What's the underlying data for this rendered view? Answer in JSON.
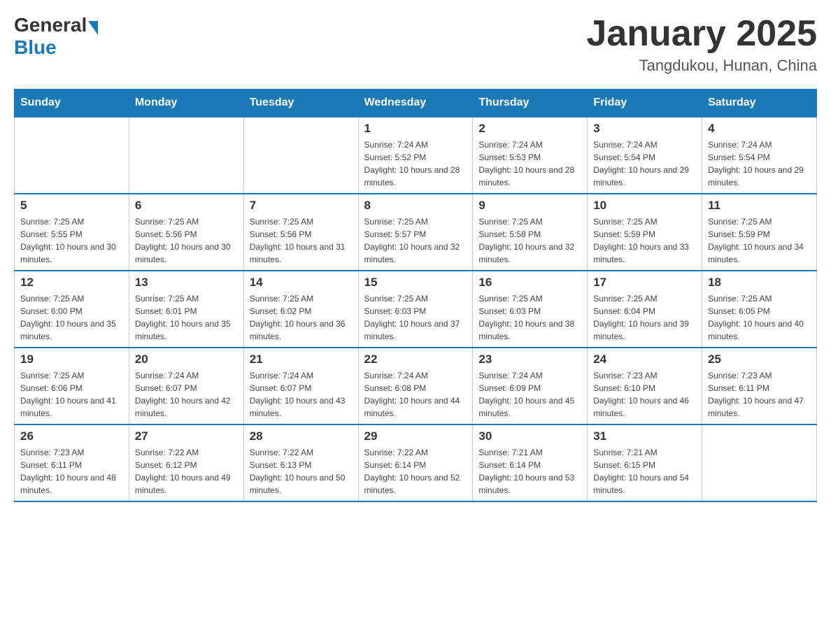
{
  "header": {
    "logo_general": "General",
    "logo_blue": "Blue",
    "month_title": "January 2025",
    "location": "Tangdukou, Hunan, China"
  },
  "days_of_week": [
    "Sunday",
    "Monday",
    "Tuesday",
    "Wednesday",
    "Thursday",
    "Friday",
    "Saturday"
  ],
  "weeks": [
    [
      {
        "day": "",
        "sunrise": "",
        "sunset": "",
        "daylight": ""
      },
      {
        "day": "",
        "sunrise": "",
        "sunset": "",
        "daylight": ""
      },
      {
        "day": "",
        "sunrise": "",
        "sunset": "",
        "daylight": ""
      },
      {
        "day": "1",
        "sunrise": "Sunrise: 7:24 AM",
        "sunset": "Sunset: 5:52 PM",
        "daylight": "Daylight: 10 hours and 28 minutes."
      },
      {
        "day": "2",
        "sunrise": "Sunrise: 7:24 AM",
        "sunset": "Sunset: 5:53 PM",
        "daylight": "Daylight: 10 hours and 28 minutes."
      },
      {
        "day": "3",
        "sunrise": "Sunrise: 7:24 AM",
        "sunset": "Sunset: 5:54 PM",
        "daylight": "Daylight: 10 hours and 29 minutes."
      },
      {
        "day": "4",
        "sunrise": "Sunrise: 7:24 AM",
        "sunset": "Sunset: 5:54 PM",
        "daylight": "Daylight: 10 hours and 29 minutes."
      }
    ],
    [
      {
        "day": "5",
        "sunrise": "Sunrise: 7:25 AM",
        "sunset": "Sunset: 5:55 PM",
        "daylight": "Daylight: 10 hours and 30 minutes."
      },
      {
        "day": "6",
        "sunrise": "Sunrise: 7:25 AM",
        "sunset": "Sunset: 5:56 PM",
        "daylight": "Daylight: 10 hours and 30 minutes."
      },
      {
        "day": "7",
        "sunrise": "Sunrise: 7:25 AM",
        "sunset": "Sunset: 5:56 PM",
        "daylight": "Daylight: 10 hours and 31 minutes."
      },
      {
        "day": "8",
        "sunrise": "Sunrise: 7:25 AM",
        "sunset": "Sunset: 5:57 PM",
        "daylight": "Daylight: 10 hours and 32 minutes."
      },
      {
        "day": "9",
        "sunrise": "Sunrise: 7:25 AM",
        "sunset": "Sunset: 5:58 PM",
        "daylight": "Daylight: 10 hours and 32 minutes."
      },
      {
        "day": "10",
        "sunrise": "Sunrise: 7:25 AM",
        "sunset": "Sunset: 5:59 PM",
        "daylight": "Daylight: 10 hours and 33 minutes."
      },
      {
        "day": "11",
        "sunrise": "Sunrise: 7:25 AM",
        "sunset": "Sunset: 5:59 PM",
        "daylight": "Daylight: 10 hours and 34 minutes."
      }
    ],
    [
      {
        "day": "12",
        "sunrise": "Sunrise: 7:25 AM",
        "sunset": "Sunset: 6:00 PM",
        "daylight": "Daylight: 10 hours and 35 minutes."
      },
      {
        "day": "13",
        "sunrise": "Sunrise: 7:25 AM",
        "sunset": "Sunset: 6:01 PM",
        "daylight": "Daylight: 10 hours and 35 minutes."
      },
      {
        "day": "14",
        "sunrise": "Sunrise: 7:25 AM",
        "sunset": "Sunset: 6:02 PM",
        "daylight": "Daylight: 10 hours and 36 minutes."
      },
      {
        "day": "15",
        "sunrise": "Sunrise: 7:25 AM",
        "sunset": "Sunset: 6:03 PM",
        "daylight": "Daylight: 10 hours and 37 minutes."
      },
      {
        "day": "16",
        "sunrise": "Sunrise: 7:25 AM",
        "sunset": "Sunset: 6:03 PM",
        "daylight": "Daylight: 10 hours and 38 minutes."
      },
      {
        "day": "17",
        "sunrise": "Sunrise: 7:25 AM",
        "sunset": "Sunset: 6:04 PM",
        "daylight": "Daylight: 10 hours and 39 minutes."
      },
      {
        "day": "18",
        "sunrise": "Sunrise: 7:25 AM",
        "sunset": "Sunset: 6:05 PM",
        "daylight": "Daylight: 10 hours and 40 minutes."
      }
    ],
    [
      {
        "day": "19",
        "sunrise": "Sunrise: 7:25 AM",
        "sunset": "Sunset: 6:06 PM",
        "daylight": "Daylight: 10 hours and 41 minutes."
      },
      {
        "day": "20",
        "sunrise": "Sunrise: 7:24 AM",
        "sunset": "Sunset: 6:07 PM",
        "daylight": "Daylight: 10 hours and 42 minutes."
      },
      {
        "day": "21",
        "sunrise": "Sunrise: 7:24 AM",
        "sunset": "Sunset: 6:07 PM",
        "daylight": "Daylight: 10 hours and 43 minutes."
      },
      {
        "day": "22",
        "sunrise": "Sunrise: 7:24 AM",
        "sunset": "Sunset: 6:08 PM",
        "daylight": "Daylight: 10 hours and 44 minutes."
      },
      {
        "day": "23",
        "sunrise": "Sunrise: 7:24 AM",
        "sunset": "Sunset: 6:09 PM",
        "daylight": "Daylight: 10 hours and 45 minutes."
      },
      {
        "day": "24",
        "sunrise": "Sunrise: 7:23 AM",
        "sunset": "Sunset: 6:10 PM",
        "daylight": "Daylight: 10 hours and 46 minutes."
      },
      {
        "day": "25",
        "sunrise": "Sunrise: 7:23 AM",
        "sunset": "Sunset: 6:11 PM",
        "daylight": "Daylight: 10 hours and 47 minutes."
      }
    ],
    [
      {
        "day": "26",
        "sunrise": "Sunrise: 7:23 AM",
        "sunset": "Sunset: 6:11 PM",
        "daylight": "Daylight: 10 hours and 48 minutes."
      },
      {
        "day": "27",
        "sunrise": "Sunrise: 7:22 AM",
        "sunset": "Sunset: 6:12 PM",
        "daylight": "Daylight: 10 hours and 49 minutes."
      },
      {
        "day": "28",
        "sunrise": "Sunrise: 7:22 AM",
        "sunset": "Sunset: 6:13 PM",
        "daylight": "Daylight: 10 hours and 50 minutes."
      },
      {
        "day": "29",
        "sunrise": "Sunrise: 7:22 AM",
        "sunset": "Sunset: 6:14 PM",
        "daylight": "Daylight: 10 hours and 52 minutes."
      },
      {
        "day": "30",
        "sunrise": "Sunrise: 7:21 AM",
        "sunset": "Sunset: 6:14 PM",
        "daylight": "Daylight: 10 hours and 53 minutes."
      },
      {
        "day": "31",
        "sunrise": "Sunrise: 7:21 AM",
        "sunset": "Sunset: 6:15 PM",
        "daylight": "Daylight: 10 hours and 54 minutes."
      },
      {
        "day": "",
        "sunrise": "",
        "sunset": "",
        "daylight": ""
      }
    ]
  ]
}
